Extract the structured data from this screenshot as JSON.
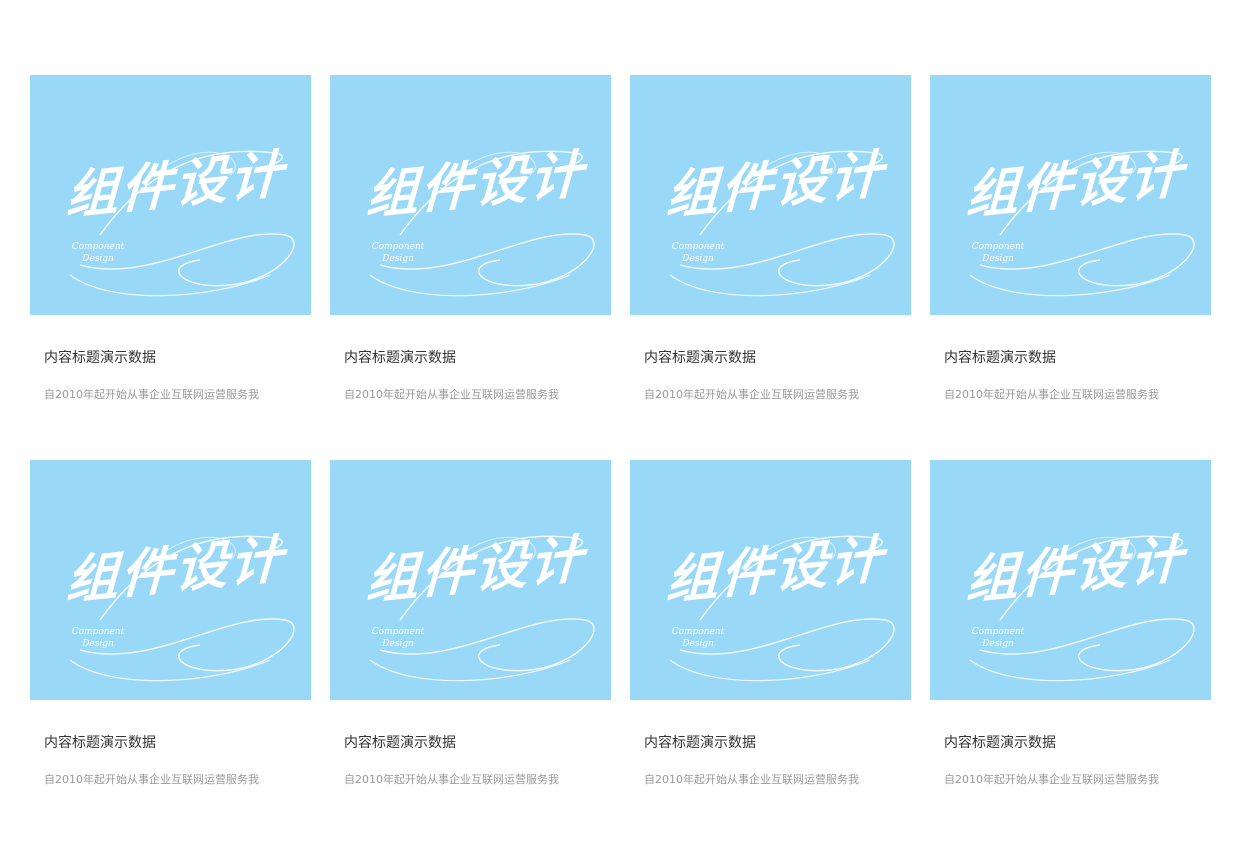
{
  "cards": [
    {
      "thumb_text": "组件设计",
      "thumb_sub_1": "Component",
      "thumb_sub_2": "Design",
      "title": "内容标题演示数据",
      "desc": "自2010年起开始从事企业互联网运营服务我"
    },
    {
      "thumb_text": "组件设计",
      "thumb_sub_1": "Component",
      "thumb_sub_2": "Design",
      "title": "内容标题演示数据",
      "desc": "自2010年起开始从事企业互联网运营服务我"
    },
    {
      "thumb_text": "组件设计",
      "thumb_sub_1": "Component",
      "thumb_sub_2": "Design",
      "title": "内容标题演示数据",
      "desc": "自2010年起开始从事企业互联网运营服务我"
    },
    {
      "thumb_text": "组件设计",
      "thumb_sub_1": "Component",
      "thumb_sub_2": "Design",
      "title": "内容标题演示数据",
      "desc": "自2010年起开始从事企业互联网运营服务我"
    },
    {
      "thumb_text": "组件设计",
      "thumb_sub_1": "Component",
      "thumb_sub_2": "Design",
      "title": "内容标题演示数据",
      "desc": "自2010年起开始从事企业互联网运营服务我"
    },
    {
      "thumb_text": "组件设计",
      "thumb_sub_1": "Component",
      "thumb_sub_2": "Design",
      "title": "内容标题演示数据",
      "desc": "自2010年起开始从事企业互联网运营服务我"
    },
    {
      "thumb_text": "组件设计",
      "thumb_sub_1": "Component",
      "thumb_sub_2": "Design",
      "title": "内容标题演示数据",
      "desc": "自2010年起开始从事企业互联网运营服务我"
    },
    {
      "thumb_text": "组件设计",
      "thumb_sub_1": "Component",
      "thumb_sub_2": "Design",
      "title": "内容标题演示数据",
      "desc": "自2010年起开始从事企业互联网运营服务我"
    }
  ],
  "colors": {
    "thumb_background": "#99d8f6",
    "title_text": "#333333",
    "desc_text": "#999999"
  }
}
